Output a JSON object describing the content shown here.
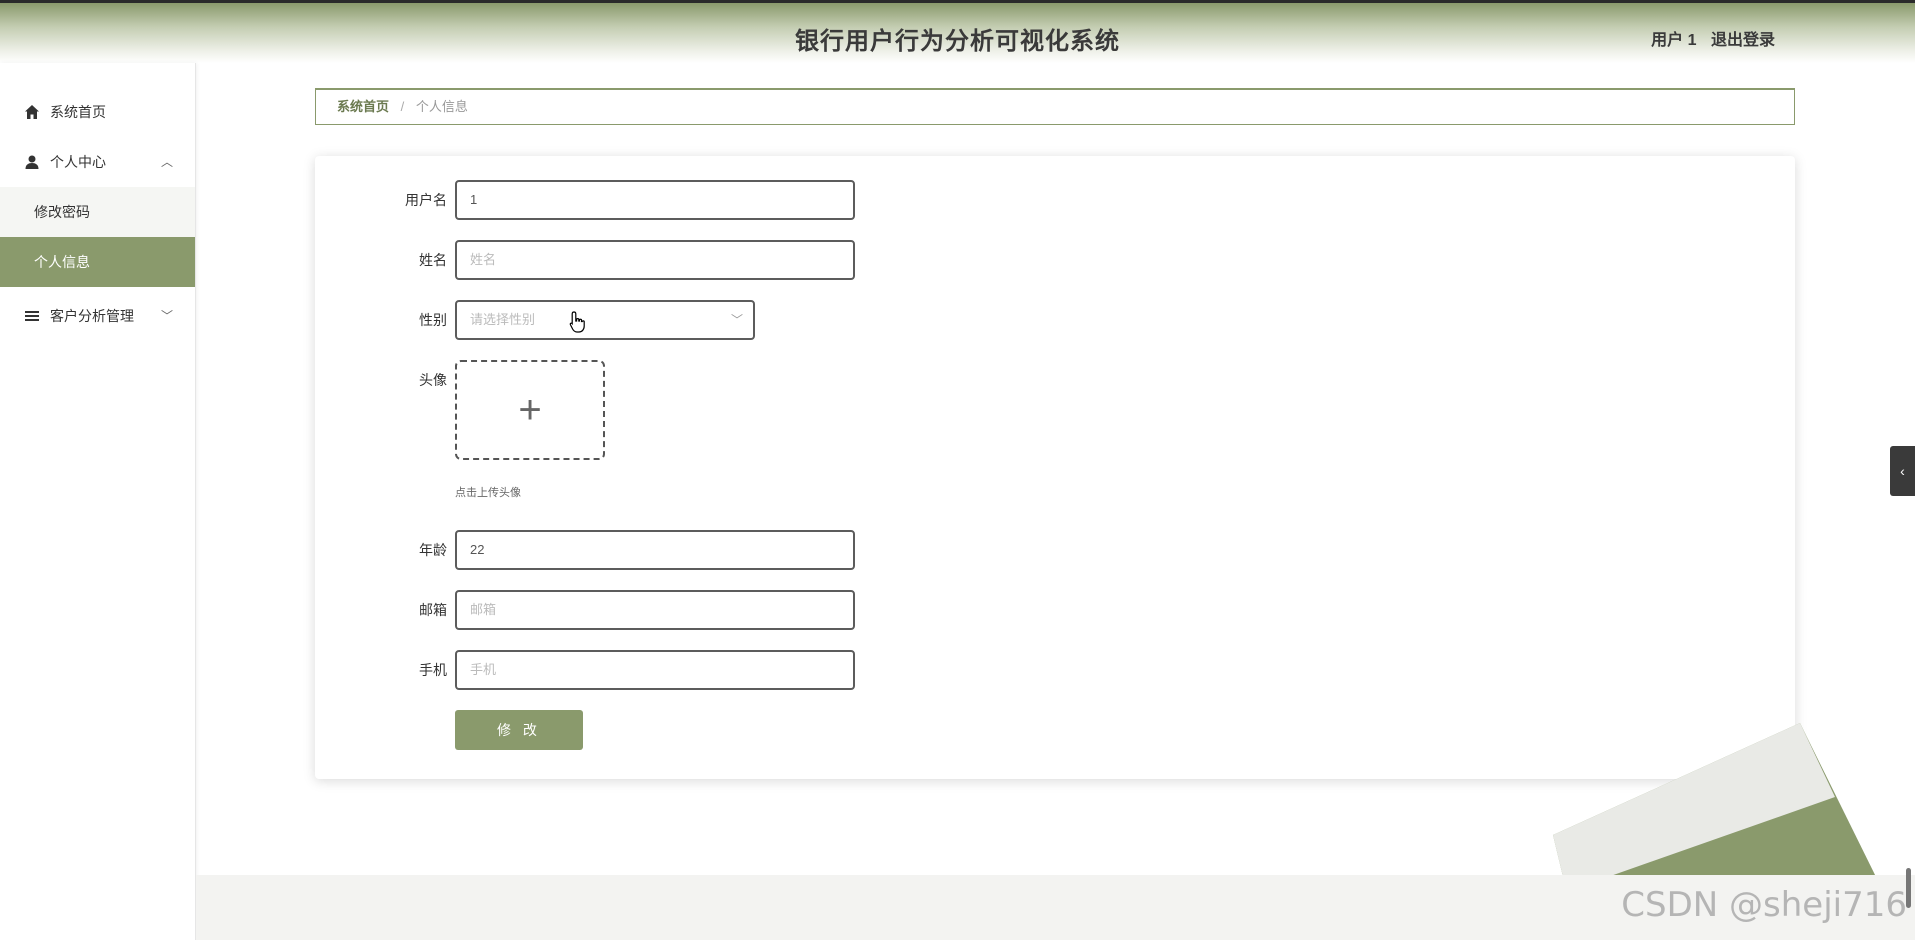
{
  "header": {
    "title": "银行用户行为分析可视化系统",
    "username": "用户 1",
    "logout_label": "退出登录"
  },
  "sidebar": {
    "items": [
      {
        "label": "系统首页",
        "icon": "home-icon"
      },
      {
        "label": "个人中心",
        "icon": "user-icon",
        "expanded": true,
        "children": [
          {
            "label": "修改密码"
          },
          {
            "label": "个人信息",
            "active": true
          }
        ]
      },
      {
        "label": "客户分析管理",
        "icon": "list-icon",
        "expanded": false
      }
    ]
  },
  "breadcrumb": {
    "home": "系统首页",
    "separator": "/",
    "current": "个人信息"
  },
  "form": {
    "username": {
      "label": "用户名",
      "value": "1"
    },
    "name": {
      "label": "姓名",
      "placeholder": "姓名"
    },
    "gender": {
      "label": "性别",
      "placeholder": "请选择性别"
    },
    "avatar": {
      "label": "头像",
      "tip": "点击上传头像"
    },
    "age": {
      "label": "年龄",
      "value": "22"
    },
    "email": {
      "label": "邮箱",
      "placeholder": "邮箱"
    },
    "phone": {
      "label": "手机",
      "placeholder": "手机"
    },
    "submit_label": "修 改"
  },
  "watermark": "CSDN @sheji716",
  "theme": {
    "accent": "#8a9a6c"
  }
}
